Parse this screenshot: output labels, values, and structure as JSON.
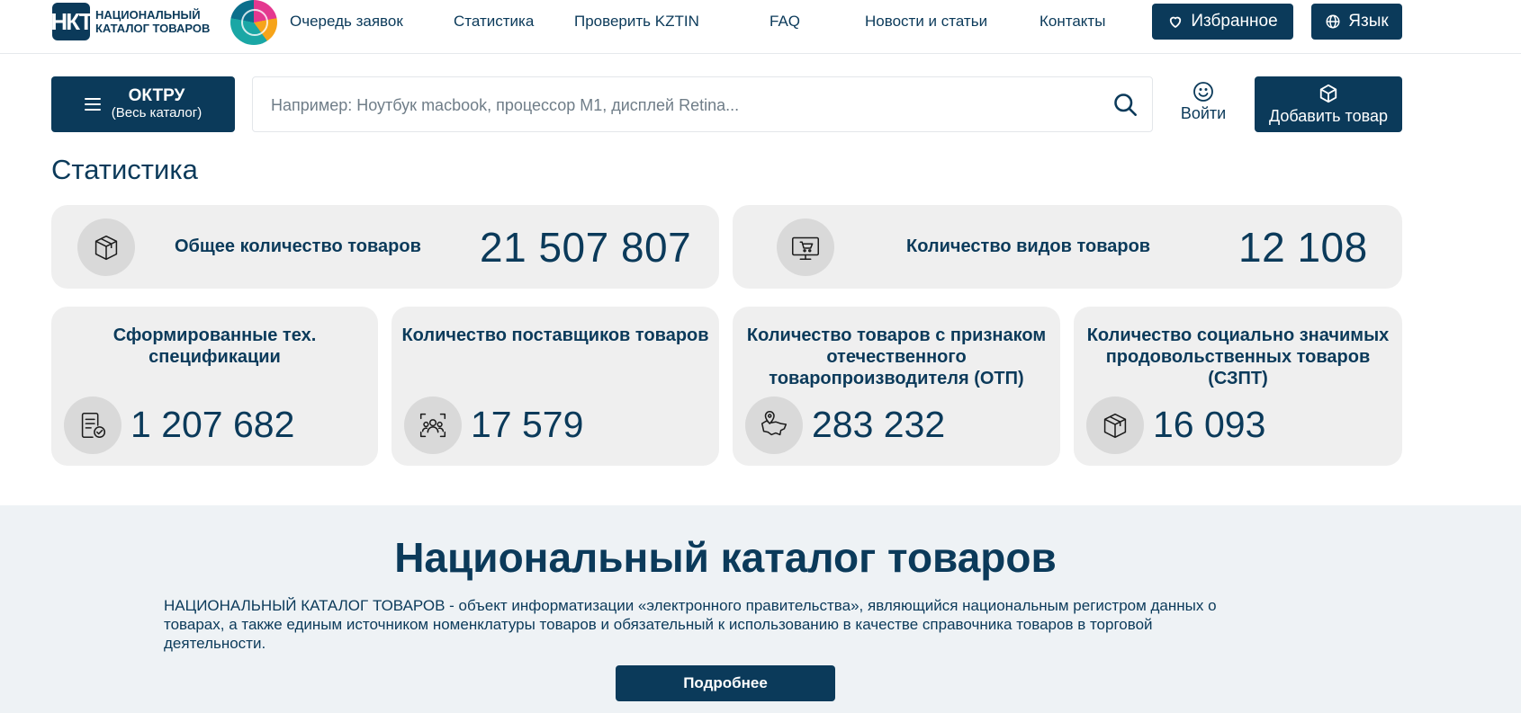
{
  "header": {
    "logo_abbr": "НКТ",
    "logo_line1": "НАЦИОНАЛЬНЫЙ",
    "logo_line2": "КАТАЛОГ ТОВАРОВ",
    "nav": [
      {
        "label": "Очередь заявок"
      },
      {
        "label": "Статистика"
      },
      {
        "label": "Проверить KZTIN"
      },
      {
        "label": "FAQ"
      },
      {
        "label": "Новости и статьи"
      },
      {
        "label": "Контакты"
      }
    ],
    "favorites_label": "Избранное",
    "language_label": "Язык"
  },
  "toolbar": {
    "catalog_title": "ОКТРУ",
    "catalog_subtitle": "(Весь каталог)",
    "search_placeholder": "Например: Ноутбук macbook, процессор M1, дисплей Retina...",
    "login_label": "Войти",
    "add_product_label": "Добавить товар"
  },
  "stats": {
    "title": "Статистика",
    "total_products": {
      "label": "Общее количество товаров",
      "value": "21 507 807",
      "icon": "box-icon"
    },
    "product_types": {
      "label": "Количество видов товаров",
      "value": "12 108",
      "icon": "monitor-cart-icon"
    },
    "small": [
      {
        "title": "Сформированные тех. спецификации",
        "value": "1 207 682",
        "icon": "document-check-icon"
      },
      {
        "title": "Количество поставщиков товаров",
        "value": "17 579",
        "icon": "people-scan-icon"
      },
      {
        "title": "Количество товаров с признаком отечественного товаропроизводителя (ОТП)",
        "value": "283 232",
        "icon": "map-pin-icon"
      },
      {
        "title": "Количество социально значимых продовольственных товаров (СЗПТ)",
        "value": "16 093",
        "icon": "box-icon"
      }
    ]
  },
  "about": {
    "title": "Национальный каталог товаров",
    "text": "НАЦИОНАЛЬНЫЙ КАТАЛОГ ТОВАРОВ - объект информатизации «электронного правительства», являющийся национальным регистром данных о товарах, а также единым источником номенклатуры товаров и обязательный к использованию в качестве справочника товаров в торговой деятельности.",
    "more_label": "Подробнее"
  },
  "colors": {
    "primary": "#0b3a5a",
    "card_bg": "#efefef",
    "icon_bg": "#d9d9d9",
    "about_bg": "#eef2f5"
  }
}
